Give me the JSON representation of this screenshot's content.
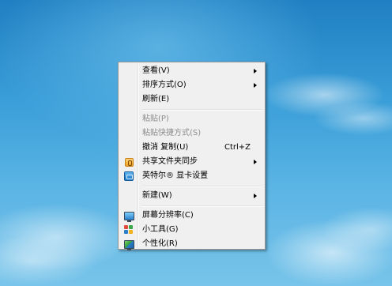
{
  "desktop": {
    "context_menu": {
      "items": [
        {
          "label": "查看(V)",
          "submenu": true
        },
        {
          "label": "排序方式(O)",
          "submenu": true
        },
        {
          "label": "刷新(E)"
        },
        {
          "label": "粘贴(P)",
          "disabled": true
        },
        {
          "label": "粘贴快捷方式(S)",
          "disabled": true
        },
        {
          "label": "撤消 复制(U)",
          "shortcut": "Ctrl+Z"
        },
        {
          "label": "共享文件夹同步",
          "submenu": true,
          "icon": "shared-folder-sync-icon"
        },
        {
          "label": "英特尔® 显卡设置",
          "icon": "intel-graphics-icon"
        },
        {
          "label": "新建(W)",
          "submenu": true
        },
        {
          "label": "屏幕分辨率(C)",
          "icon": "screen-resolution-icon"
        },
        {
          "label": "小工具(G)",
          "icon": "gadgets-icon"
        },
        {
          "label": "个性化(R)",
          "icon": "personalize-icon"
        }
      ]
    }
  },
  "colors": {
    "menu_background": "#f0f0f0",
    "menu_border": "#979797",
    "disabled_text": "#8d8d8d",
    "sky_top": "#1f7fc2",
    "sky_bottom": "#78c4ea"
  }
}
